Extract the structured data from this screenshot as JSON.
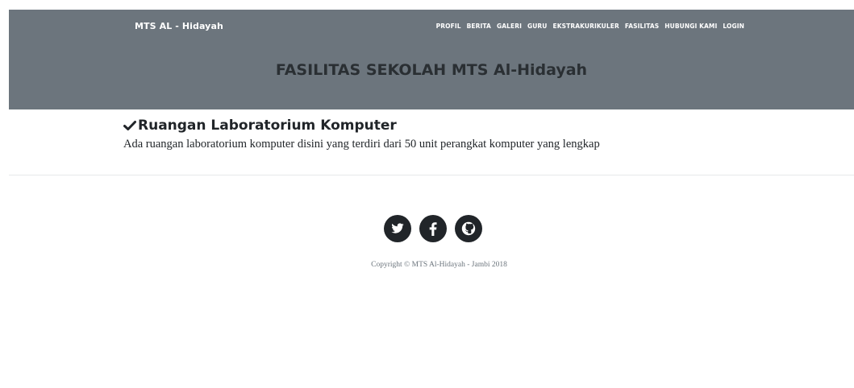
{
  "navbar": {
    "brand": "MTS AL - Hidayah",
    "items": [
      {
        "label": "PROFIL"
      },
      {
        "label": "BERITA"
      },
      {
        "label": "GALERI"
      },
      {
        "label": "GURU"
      },
      {
        "label": "EKSTRAKURIKULER"
      },
      {
        "label": "FASILITAS"
      },
      {
        "label": "HUBUNGI KAMI"
      },
      {
        "label": "LOGIN"
      }
    ]
  },
  "header": {
    "title": "FASILITAS SEKOLAH MTS Al-Hidayah"
  },
  "facility": {
    "icon": "check-icon",
    "title": "Ruangan Laboratorium Komputer",
    "description": "Ada ruangan laboratorium komputer disini yang terdiri dari 50 unit perangkat komputer yang lengkap"
  },
  "footer": {
    "social": [
      {
        "icon": "twitter-icon"
      },
      {
        "icon": "facebook-icon"
      },
      {
        "icon": "github-icon"
      }
    ],
    "copyright": "Copyright © MTS Al-Hidayah - Jambi 2018"
  },
  "colors": {
    "header_bg": "#6c757d",
    "header_title": "#2a2f33",
    "nav_text": "#ffffff",
    "social_bg": "#212529",
    "text": "#212529",
    "muted": "#6c757d"
  }
}
